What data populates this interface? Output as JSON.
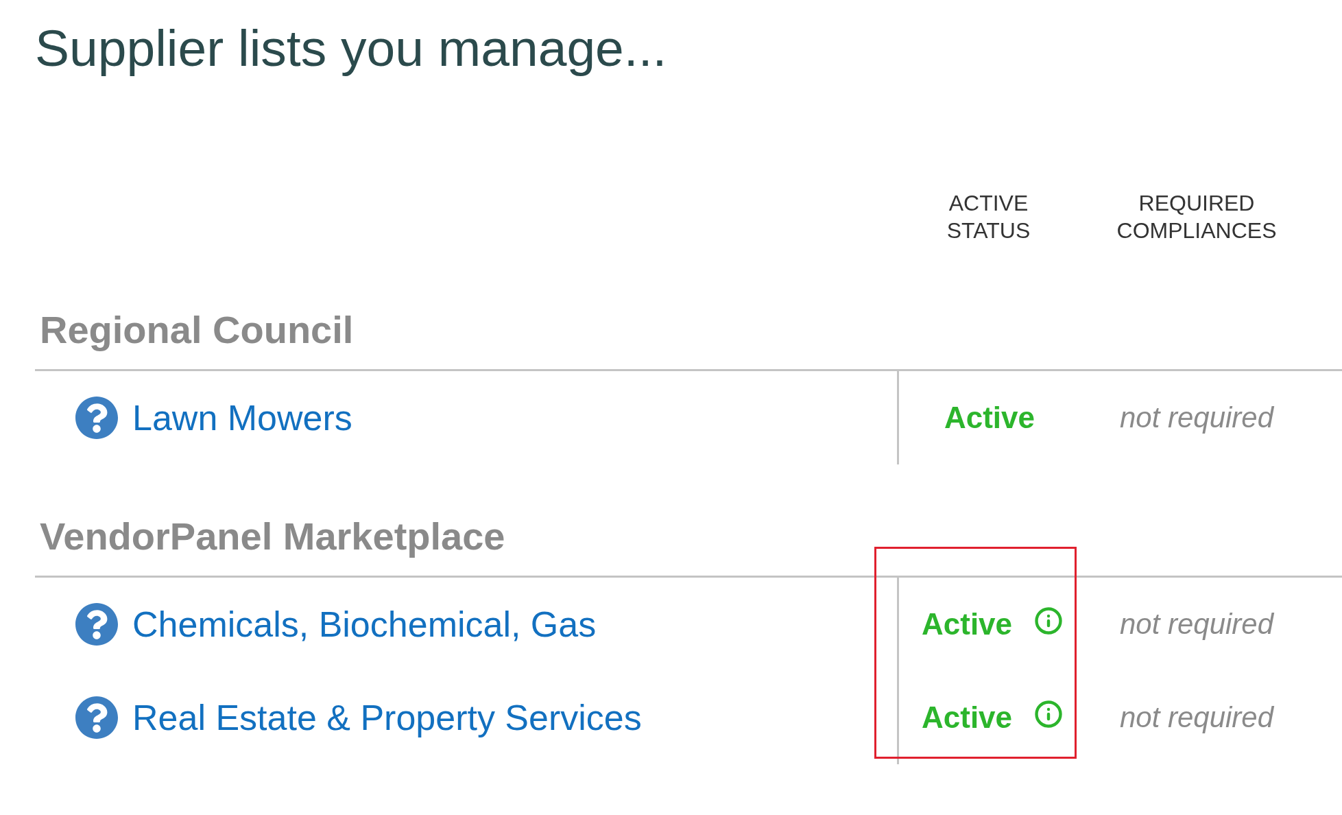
{
  "title": "Supplier lists you manage...",
  "columns": [
    "ACTIVE STATUS",
    "REQUIRED COMPLIANCES"
  ],
  "sections": [
    {
      "name": "Regional Council",
      "highlighted": false,
      "rows": [
        {
          "name": "Lawn Mowers",
          "status": "Active",
          "info": false,
          "compliance": "not required"
        }
      ]
    },
    {
      "name": "VendorPanel Marketplace",
      "highlighted": true,
      "rows": [
        {
          "name": "Chemicals, Biochemical, Gas",
          "status": "Active",
          "info": true,
          "compliance": "not required"
        },
        {
          "name": "Real Estate & Property Services",
          "status": "Active",
          "info": true,
          "compliance": "not required"
        }
      ]
    }
  ]
}
